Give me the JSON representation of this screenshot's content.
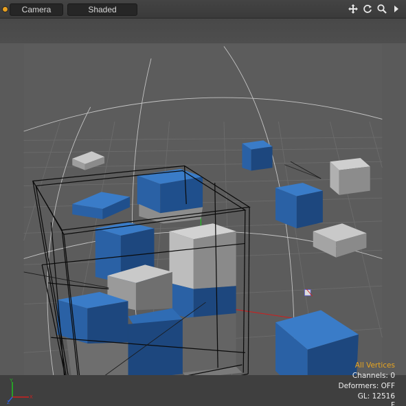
{
  "header": {
    "tabs": [
      {
        "label": "Camera"
      },
      {
        "label": "Shaded"
      }
    ],
    "tools": [
      {
        "icon": "move-icon"
      },
      {
        "icon": "rotate-icon"
      },
      {
        "icon": "zoom-icon"
      },
      {
        "icon": "expand-arrow-icon"
      }
    ]
  },
  "info": {
    "selection_mode": "All Vertices",
    "channels": "Channels: 0",
    "deformers": "Deformers: OFF",
    "gl": "GL: 12516",
    "extra": "F"
  },
  "gizmo": {
    "y": "Y",
    "x": "X",
    "z": "Z"
  },
  "colors": {
    "accent": "#e8a520",
    "cube_blue": "#2f6cb4",
    "cube_grey": "#a8a8a8",
    "x_axis": "#d02020",
    "y_axis": "#20c020"
  }
}
